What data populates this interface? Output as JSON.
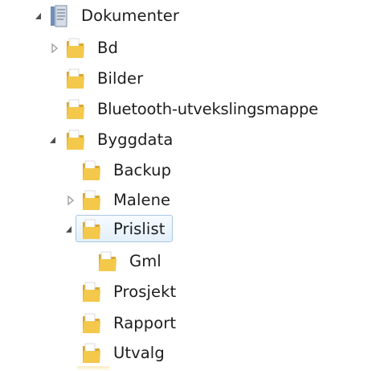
{
  "tree": {
    "items": [
      {
        "label": "Dokumenter",
        "icon": "library-icon",
        "toggle": "expanded"
      },
      {
        "label": "Bd",
        "icon": "folder-icon",
        "toggle": "collapsed"
      },
      {
        "label": "Bilder",
        "icon": "folder-icon",
        "toggle": "none"
      },
      {
        "label": "Bluetooth-utvekslingsmappe",
        "icon": "folder-icon",
        "toggle": "none"
      },
      {
        "label": "Byggdata",
        "icon": "folder-icon",
        "toggle": "expanded"
      },
      {
        "label": "Backup",
        "icon": "folder-icon",
        "toggle": "none"
      },
      {
        "label": "Malene",
        "icon": "folder-icon",
        "toggle": "collapsed"
      },
      {
        "label": "Prislist",
        "icon": "folder-icon",
        "toggle": "expanded",
        "selected": true
      },
      {
        "label": "Gml",
        "icon": "folder-icon",
        "toggle": "none"
      },
      {
        "label": "Prosjekt",
        "icon": "folder-icon",
        "toggle": "none"
      },
      {
        "label": "Rapport",
        "icon": "folder-icon",
        "toggle": "none"
      },
      {
        "label": "Utvalg",
        "icon": "folder-icon",
        "toggle": "none"
      }
    ]
  },
  "colors": {
    "selection_border": "#a9c8e4",
    "selection_fill": "#e3effa",
    "folder_yellow": "#f0c44a",
    "toggle_filled": "#505050",
    "toggle_outline": "#9a9a9a"
  }
}
